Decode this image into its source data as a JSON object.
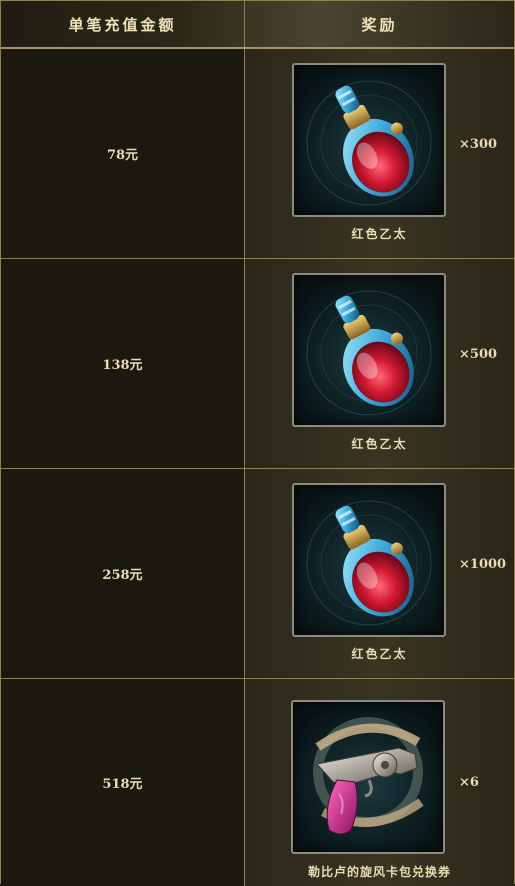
{
  "header": {
    "amount_label": "单笔充值金额",
    "reward_label": "奖励"
  },
  "rows": [
    {
      "amount": "78元",
      "item_name": "红色乙太",
      "quantity": "×300",
      "icon": "red-potion-icon"
    },
    {
      "amount": "138元",
      "item_name": "红色乙太",
      "quantity": "×500",
      "icon": "red-potion-icon"
    },
    {
      "amount": "258元",
      "item_name": "红色乙太",
      "quantity": "×1000",
      "icon": "red-potion-icon"
    },
    {
      "amount": "518元",
      "item_name": "勒比卢的旋风卡包兑换券",
      "quantity": "×6",
      "icon": "revolver-icon"
    }
  ],
  "colors": {
    "border": "#8c8056",
    "text": "#e9dcb4",
    "potion_red": "#c4122a",
    "potion_glass": "#3fb7e6"
  }
}
